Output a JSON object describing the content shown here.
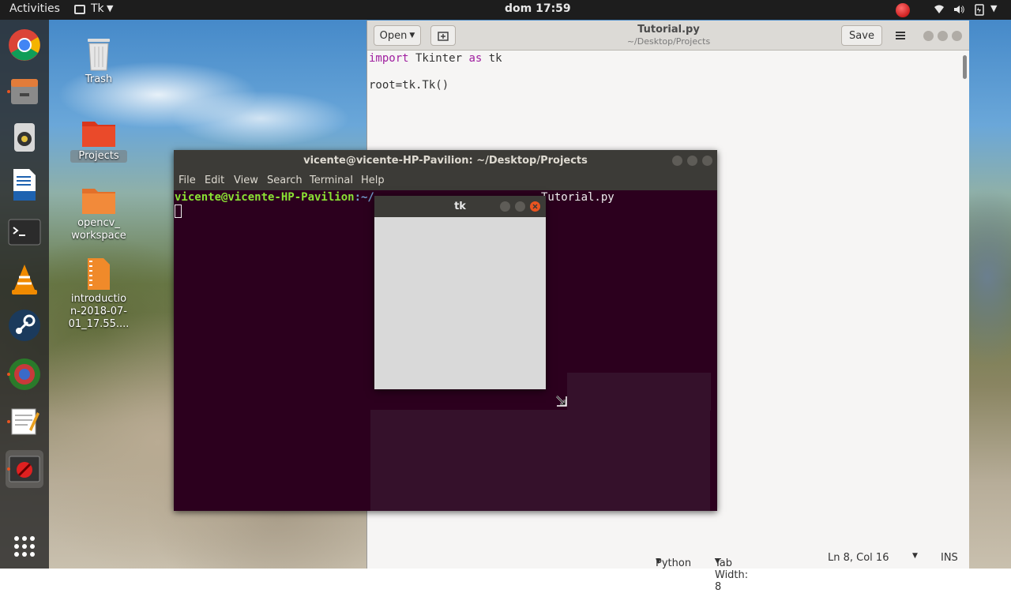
{
  "topbar": {
    "activities": "Activities",
    "app_menu": "Tk",
    "clock": "dom 17:59"
  },
  "dock": {
    "items": [
      "chrome-icon",
      "files-icon",
      "rhythmbox-icon",
      "writer-icon",
      "terminal-icon",
      "vlc-icon",
      "steam-icon",
      "browser-icon",
      "text-editor-icon",
      "tk-app-icon",
      "show-apps-icon"
    ]
  },
  "desktop": {
    "icons": [
      {
        "label": "Trash"
      },
      {
        "label": "Projects"
      },
      {
        "label": "opencv_\nworkspace"
      },
      {
        "label": "introductio\nn-2018-07-\n01_17.55...."
      }
    ]
  },
  "gedit": {
    "open_label": "Open",
    "title": "Tutorial.py",
    "subtitle": "~/Desktop/Projects",
    "save_label": "Save",
    "code": {
      "line1_kw1": "import",
      "line1_mid": " Tkinter ",
      "line1_kw2": "as",
      "line1_end": " tk",
      "line3": "root=tk.Tk()"
    },
    "status": {
      "language": "Python",
      "tab_width": "Tab Width: 8",
      "position": "Ln 8, Col 16",
      "mode": "INS"
    }
  },
  "terminal": {
    "title": "vicente@vicente-HP-Pavilion: ~/Desktop/Projects",
    "menu": [
      "File",
      "Edit",
      "View",
      "Search",
      "Terminal",
      "Help"
    ],
    "prompt_user": "vicente@vicente-HP-Pavilion",
    "prompt_path": ":~/",
    "command_visible": "Tutorial.py"
  },
  "tk_window": {
    "title": "tk"
  },
  "colors": {
    "terminal_bg": "#2c001e",
    "prompt_green": "#8ae234",
    "prompt_blue": "#729fcf",
    "ubuntu_orange": "#e95420"
  }
}
